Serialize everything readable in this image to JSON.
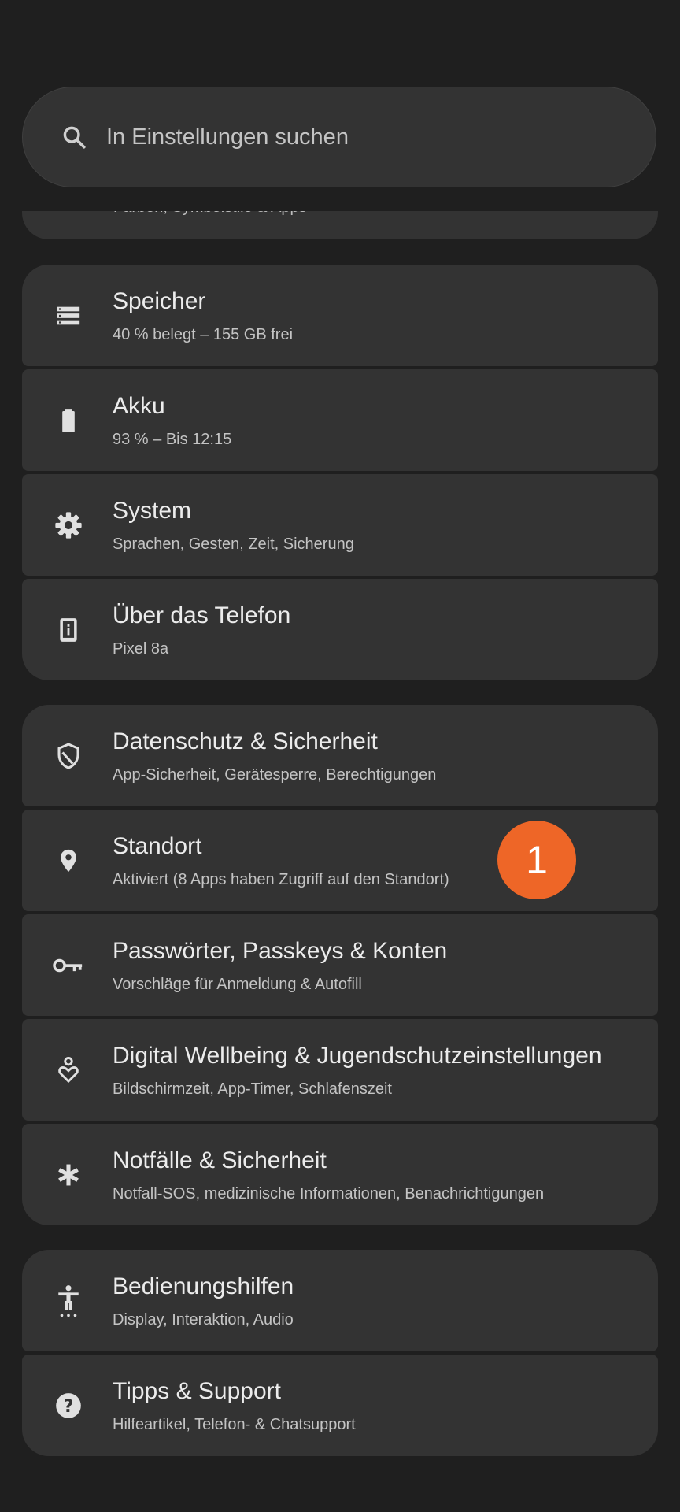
{
  "search": {
    "placeholder": "In Einstellungen suchen"
  },
  "partial_item": {
    "subtitle_cut": "Farben, Symbolstile & Apps"
  },
  "groups": [
    {
      "items": [
        {
          "icon": "storage-icon",
          "title": "Speicher",
          "subtitle": "40 % belegt – 155 GB frei"
        },
        {
          "icon": "battery-icon",
          "title": "Akku",
          "subtitle": "93 % – Bis 12:15"
        },
        {
          "icon": "gear-icon",
          "title": "System",
          "subtitle": "Sprachen, Gesten, Zeit, Sicherung"
        },
        {
          "icon": "phone-info-icon",
          "title": "Über das Telefon",
          "subtitle": "Pixel 8a"
        }
      ]
    },
    {
      "items": [
        {
          "icon": "shield-icon",
          "title": "Datenschutz & Sicherheit",
          "subtitle": "App-Sicherheit, Gerätesperre, Berechtigungen"
        },
        {
          "icon": "location-pin-icon",
          "title": "Standort",
          "subtitle": "Aktiviert (8 Apps haben Zugriff auf den Standort)"
        },
        {
          "icon": "key-icon",
          "title": "Passwörter, Passkeys & Konten",
          "subtitle": "Vorschläge für Anmeldung & Autofill"
        },
        {
          "icon": "wellbeing-icon",
          "title": "Digital Wellbeing & Jugendschutzeinstellungen",
          "subtitle": "Bildschirmzeit, App-Timer, Schlafenszeit"
        },
        {
          "icon": "asterisk-icon",
          "title": "Notfälle & Sicherheit",
          "subtitle": "Notfall-SOS, medizinische Informationen, Benachrichtigungen"
        }
      ]
    },
    {
      "items": [
        {
          "icon": "accessibility-icon",
          "title": "Bedienungshilfen",
          "subtitle": "Display, Interaktion, Audio"
        },
        {
          "icon": "help-icon",
          "title": "Tipps & Support",
          "subtitle": "Hilfeartikel, Telefon- & Chatsupport"
        }
      ]
    }
  ],
  "annotation_badge": {
    "label": "1",
    "color": "#ee6627"
  }
}
